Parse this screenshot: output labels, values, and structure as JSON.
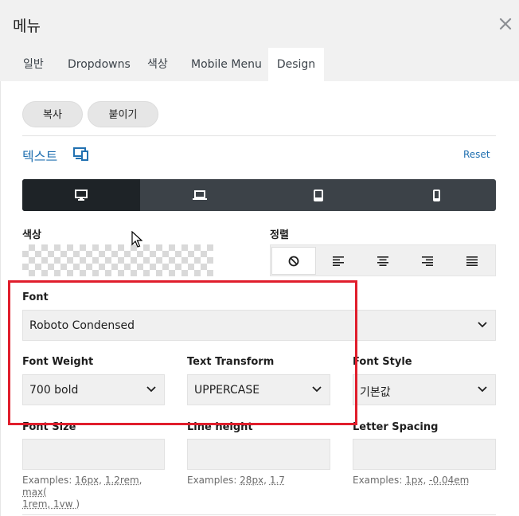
{
  "window": {
    "title": "메뉴",
    "close_icon": "close-icon"
  },
  "tabs": [
    {
      "label": "일반"
    },
    {
      "label": "Dropdowns"
    },
    {
      "label": "색상"
    },
    {
      "label": "Mobile Menu"
    },
    {
      "label": "Design",
      "active": true
    }
  ],
  "actions": {
    "copy_label": "복사",
    "paste_label": "붙이기"
  },
  "text_section": {
    "title": "텍스트",
    "responsive_icon": "responsive-devices-icon",
    "reset_label": "Reset"
  },
  "devices": [
    {
      "icon": "desktop-icon",
      "active": true
    },
    {
      "icon": "laptop-icon"
    },
    {
      "icon": "tablet-icon"
    },
    {
      "icon": "mobile-icon"
    }
  ],
  "color": {
    "label": "색상",
    "value": "transparent"
  },
  "alignment": {
    "label": "정렬",
    "options": [
      {
        "icon": "no-alignment-icon",
        "active": true
      },
      {
        "icon": "align-left-icon"
      },
      {
        "icon": "align-center-icon"
      },
      {
        "icon": "align-right-icon"
      },
      {
        "icon": "align-justify-icon"
      }
    ]
  },
  "font": {
    "label": "Font",
    "value": "Roboto Condensed"
  },
  "font_weight": {
    "label": "Font Weight",
    "value": "700 bold"
  },
  "text_transform": {
    "label": "Text Transform",
    "value": "UPPERCASE"
  },
  "font_style": {
    "label": "Font Style",
    "value": "기본값"
  },
  "font_size": {
    "label": "Font Size",
    "value": "",
    "hint_prefix": "Examples: ",
    "examples": [
      "16px",
      "1.2rem",
      "max(",
      "1rem, 1vw )"
    ]
  },
  "line_height": {
    "label": "Line height",
    "value": "",
    "hint_prefix": "Examples: ",
    "examples": [
      "28px",
      "1.7"
    ]
  },
  "letter_spacing": {
    "label": "Letter Spacing",
    "value": "",
    "hint_prefix": "Examples: ",
    "examples": [
      "1px",
      "-0.04em"
    ]
  },
  "colors": {
    "accent": "#2271b1",
    "highlight": "#e01e2c",
    "device_bar": "#3c4248",
    "device_active": "#1e2327"
  }
}
